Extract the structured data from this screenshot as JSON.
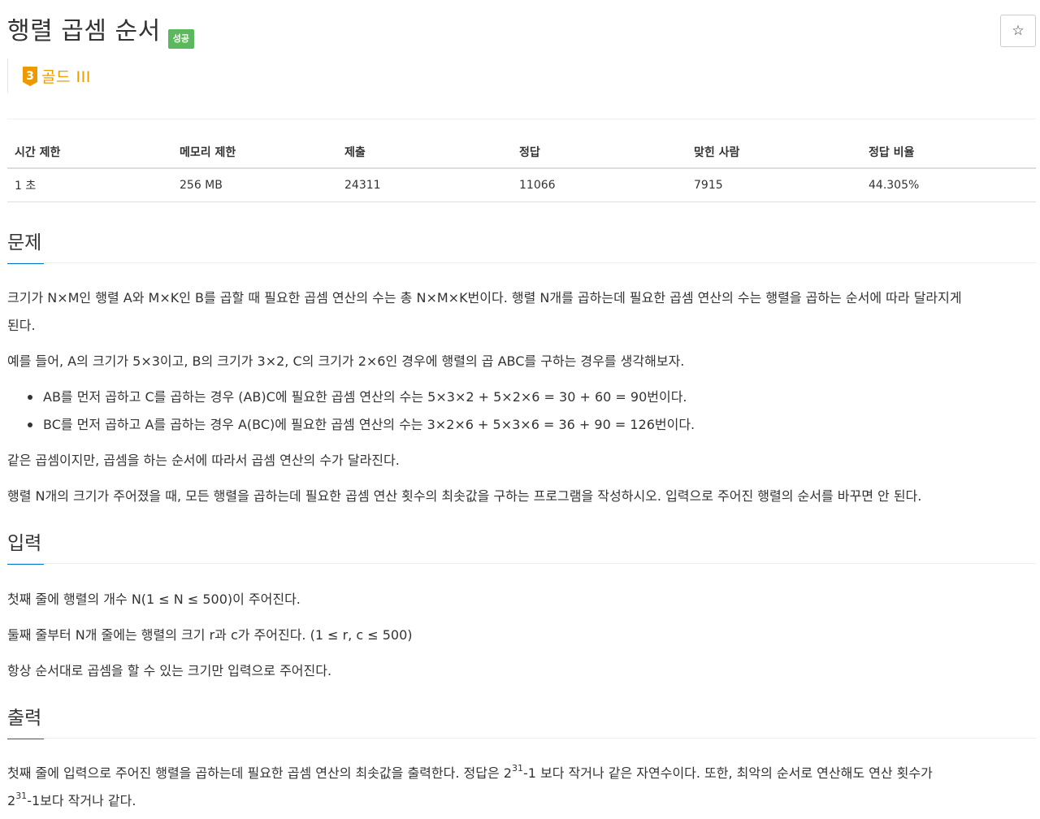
{
  "problem": {
    "title": "행렬 곱셈 순서",
    "status_badge": "성공",
    "tier": {
      "number": "3",
      "label": "골드 III",
      "color": "#ec9a00"
    },
    "star_icon": "star-outline-icon"
  },
  "stats": {
    "headers": [
      "시간 제한",
      "메모리 제한",
      "제출",
      "정답",
      "맞힌 사람",
      "정답 비율"
    ],
    "values": [
      "1 초",
      "256 MB",
      "24311",
      "11066",
      "7915",
      "44.305%"
    ]
  },
  "sections": {
    "problem": {
      "heading": "문제",
      "p1_line1": "크기가 N×M인 행렬 A와 M×K인 B를 곱할 때 필요한 곱셈 연산의 수는 총 N×M×K번이다. 행렬 N개를 곱하는데 필요한 곱셈 연산의 수는 행렬을 곱하는 순서에 따라 달라지게",
      "p1_line2": "된다.",
      "p2": "예를 들어, A의 크기가 5×3이고, B의 크기가 3×2, C의 크기가 2×6인 경우에 행렬의 곱 ABC를 구하는 경우를 생각해보자.",
      "bullets": [
        "AB를 먼저 곱하고 C를 곱하는 경우 (AB)C에 필요한 곱셈 연산의 수는 5×3×2 + 5×2×6 = 30 + 60 = 90번이다.",
        "BC를 먼저 곱하고 A를 곱하는 경우 A(BC)에 필요한 곱셈 연산의 수는 3×2×6 + 5×3×6 = 36 + 90 = 126번이다."
      ],
      "p3": "같은 곱셈이지만, 곱셈을 하는 순서에 따라서 곱셈 연산의 수가 달라진다.",
      "p4": "행렬 N개의 크기가 주어졌을 때, 모든 행렬을 곱하는데 필요한 곱셈 연산 횟수의 최솟값을 구하는 프로그램을 작성하시오. 입력으로 주어진 행렬의 순서를 바꾸면 안 된다."
    },
    "input": {
      "heading": "입력",
      "p1": "첫째 줄에 행렬의 개수 N(1 ≤ N ≤ 500)이 주어진다.",
      "p2": "둘째 줄부터 N개 줄에는 행렬의 크기 r과 c가 주어진다. (1 ≤ r, c ≤ 500)",
      "p3": "항상 순서대로 곱셈을 할 수 있는 크기만 입력으로 주어진다."
    },
    "output": {
      "heading": "출력",
      "l1_a": "첫째 줄에 입력으로 주어진 행렬을 곱하는데 필요한 곱셈 연산의 최솟값을 출력한다. 정답은 2",
      "l1_sup": "31",
      "l1_b": "-1 보다 작거나 같은 자연수이다. 또한, 최악의 순서로 연산해도 연산 횟수가",
      "l2_a": "2",
      "l2_sup": "31",
      "l2_b": "-1보다 작거나 같다."
    }
  },
  "colors": {
    "badge": "#5cb85c",
    "accent_underline": "#0076c0",
    "tier": "#ec9a00"
  }
}
